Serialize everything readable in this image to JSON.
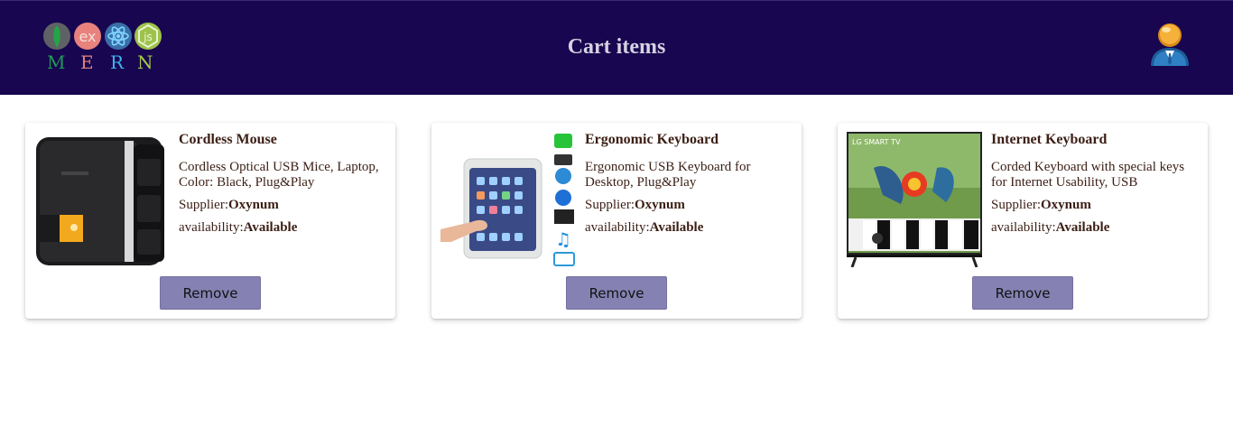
{
  "header": {
    "logo_letters": [
      "M",
      "E",
      "R",
      "N"
    ],
    "logo_letter_colors": [
      "#1f9d55",
      "#e0837a",
      "#3fb3f0",
      "#a4c94a"
    ],
    "logo_express_text": "ex",
    "logo_js_text": "js",
    "title": "Cart items",
    "background": "#180650"
  },
  "cart": {
    "items": [
      {
        "name": "Cordless Mouse",
        "description": "Cordless Optical USB Mice, Laptop, Color: Black, Plug&Play",
        "supplier_label": "Supplier:",
        "supplier": "Oxynum",
        "availability_label": "availability:",
        "availability": "Available",
        "image_icon": "stabilizer-image",
        "remove_label": "Remove"
      },
      {
        "name": "Ergonomic Keyboard",
        "description": "Ergonomic USB Keyboard for Desktop, Plug&Play",
        "supplier_label": "Supplier:",
        "supplier": "Oxynum",
        "availability_label": "availability:",
        "availability": "Available",
        "image_icon": "waterproof-phone-pouch-image",
        "remove_label": "Remove"
      },
      {
        "name": "Internet Keyboard",
        "description": "Corded Keyboard with special keys for Internet Usability, USB",
        "supplier_label": "Supplier:",
        "supplier": "Oxynum",
        "availability_label": "availability:",
        "availability": "Available",
        "image_icon": "lg-smart-tv-image",
        "image_text": "LG SMART TV",
        "remove_label": "Remove"
      }
    ]
  },
  "colors": {
    "button": "#8581b2",
    "text": "#3b1e14"
  }
}
